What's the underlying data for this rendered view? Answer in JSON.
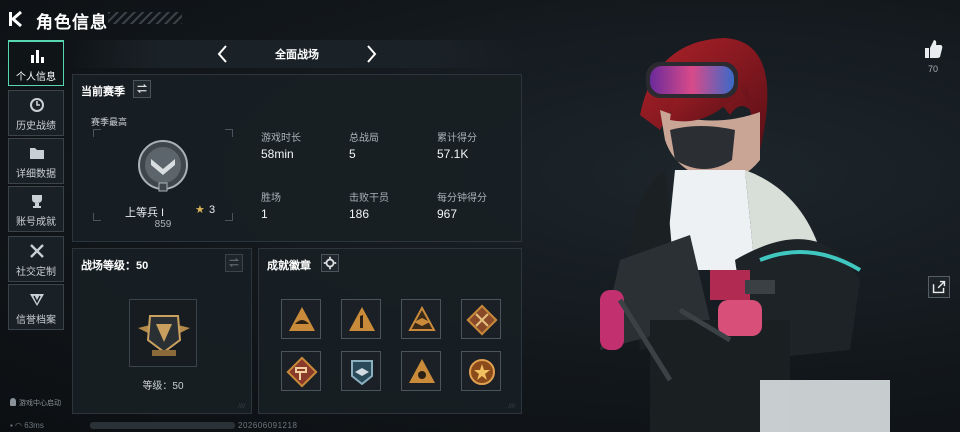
{
  "header": {
    "title": "角色信息"
  },
  "sidebar": {
    "items": [
      {
        "label": "个人信息",
        "icon": "bar-chart-icon",
        "active": true
      },
      {
        "label": "历史战绩",
        "icon": "clock-icon",
        "active": false
      },
      {
        "label": "详细数据",
        "icon": "folder-icon",
        "active": false
      },
      {
        "label": "账号成就",
        "icon": "trophy-icon",
        "active": false
      },
      {
        "label": "社交定制",
        "icon": "tools-icon",
        "active": false
      },
      {
        "label": "信誉档案",
        "icon": "shield-icon",
        "active": false
      }
    ]
  },
  "mode": {
    "label": "全面战场"
  },
  "season": {
    "title": "当前赛季",
    "subtitle": "赛季最高",
    "rank_name": "上等兵 I",
    "rank_stars": "3",
    "rank_points": "859",
    "stats": [
      {
        "label": "游戏时长",
        "value": "58min"
      },
      {
        "label": "总战局",
        "value": "5"
      },
      {
        "label": "累计得分",
        "value": "57.1K"
      },
      {
        "label": "胜场",
        "value": "1"
      },
      {
        "label": "击败干员",
        "value": "186"
      },
      {
        "label": "每分钟得分",
        "value": "967"
      }
    ]
  },
  "battle_level": {
    "title": "战场等级：50",
    "level_text": "等级：50"
  },
  "badges": {
    "title": "成就徽章",
    "items": [
      "helmet-badge-icon",
      "number-one-badge-icon",
      "wings-badge-icon",
      "crossed-guns-badge-icon",
      "hammer-badge-icon",
      "eagle-badge-icon",
      "target-badge-icon",
      "star-medal-badge-icon"
    ]
  },
  "social": {
    "likes": "70"
  },
  "footer": {
    "hint": "游戏中心启动",
    "ping": "63ms",
    "uid": "202606091218"
  },
  "colors": {
    "accent": "#58d7b3",
    "panel": "#181f24",
    "badge_gold": "#c98a3a"
  }
}
